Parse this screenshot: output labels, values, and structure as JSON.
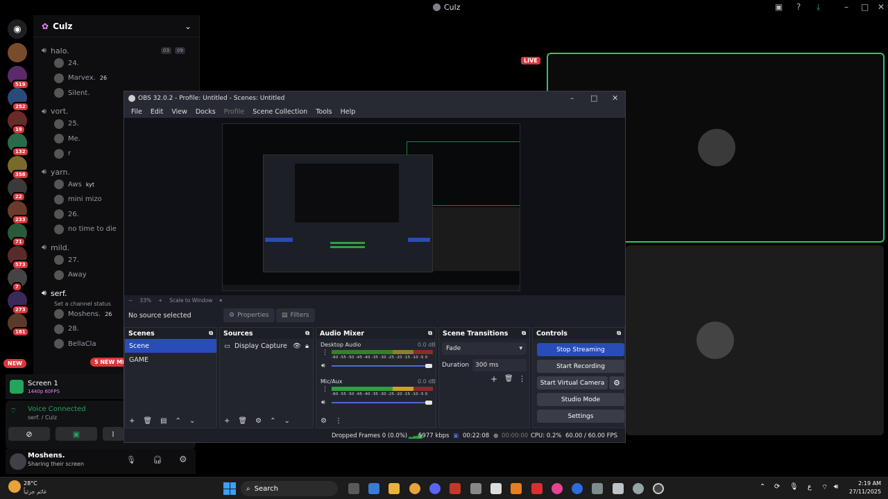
{
  "discord": {
    "window_title": "Culz",
    "guild_name": "Culz",
    "live_badge": "LIVE",
    "new_badge": "NEW",
    "new_mentions": "5 NEW MENTIONS",
    "servers": [
      {
        "badge": ""
      },
      {
        "badge": "519"
      },
      {
        "badge": "252"
      },
      {
        "badge": "19"
      },
      {
        "badge": "132"
      },
      {
        "badge": "358"
      },
      {
        "badge": "22"
      },
      {
        "badge": "233"
      },
      {
        "badge": "71"
      },
      {
        "badge": "573"
      },
      {
        "badge": "7"
      },
      {
        "badge": "273"
      },
      {
        "badge": "181"
      }
    ],
    "channels": [
      {
        "name": "halo.",
        "counter_a": "03",
        "counter_b": "09",
        "members": [
          "24.",
          "Marvex.",
          "Silent."
        ],
        "member_extra": [
          "",
          "26",
          ""
        ]
      },
      {
        "name": "vort.",
        "members": [
          "25.",
          "Me.",
          "r"
        ]
      },
      {
        "name": "yarn.",
        "members": [
          "Aws",
          "mini mizo",
          "26.",
          "no time to die"
        ],
        "member_extra": [
          "kyt",
          "",
          "",
          ""
        ]
      },
      {
        "name": "mild.",
        "members": [
          "27.",
          "Away"
        ]
      },
      {
        "name": "serf.",
        "status": "Set a channel status",
        "members": [
          "Moshens.",
          "28.",
          "BellaCla"
        ],
        "member_extra": [
          "26",
          "",
          ""
        ]
      }
    ],
    "screen_panel": {
      "title": "Screen 1",
      "sub": "1440p 60FPS"
    },
    "voice_panel": {
      "status": "Voice Connected",
      "location": "serf. / Culz"
    },
    "user_panel": {
      "name": "Moshens.",
      "status": "Sharing their screen"
    }
  },
  "obs": {
    "title": "OBS 32.0.2 - Profile: Untitled - Scenes: Untitled",
    "menu": [
      "File",
      "Edit",
      "View",
      "Docks",
      "Profile",
      "Scene Collection",
      "Tools",
      "Help"
    ],
    "zoom": "33%",
    "scale_mode": "Scale to Window",
    "no_source": "No source selected",
    "properties": "Properties",
    "filters": "Filters",
    "docks": {
      "scenes": {
        "title": "Scenes",
        "items": [
          "Scene",
          "GAME"
        ]
      },
      "sources": {
        "title": "Sources",
        "items": [
          "Display Capture"
        ]
      },
      "mixer": {
        "title": "Audio Mixer",
        "channels": [
          {
            "name": "Desktop Audio",
            "db": "0.0 dB"
          },
          {
            "name": "Mic/Aux",
            "db": "0.0 dB"
          }
        ],
        "scale": "-60 -55 -50 -45 -40 -35 -30 -25 -20 -15 -10 -5 0"
      },
      "transitions": {
        "title": "Scene Transitions",
        "type": "Fade",
        "duration_label": "Duration",
        "duration": "300 ms"
      },
      "controls": {
        "title": "Controls",
        "buttons": [
          "Stop Streaming",
          "Start Recording",
          "Start Virtual Camera",
          "Studio Mode",
          "Settings"
        ]
      }
    },
    "status": {
      "dropped": "Dropped Frames 0 (0.0%)",
      "bitrate": "5977 kbps",
      "stream_time": "00:22:08",
      "rec_time": "00:00:00",
      "cpu": "CPU: 0.2%",
      "fps": "60.00 / 60.00 FPS"
    }
  },
  "taskbar": {
    "weather_temp": "28°C",
    "weather_desc": "غائم جزئياً",
    "search": "Search",
    "time": "2:19 AM",
    "date": "27/11/2025",
    "lang": "ع"
  },
  "colors": {
    "accent": "#284cb8",
    "live_green": "#33c46b",
    "discord_red": "#da373c"
  }
}
